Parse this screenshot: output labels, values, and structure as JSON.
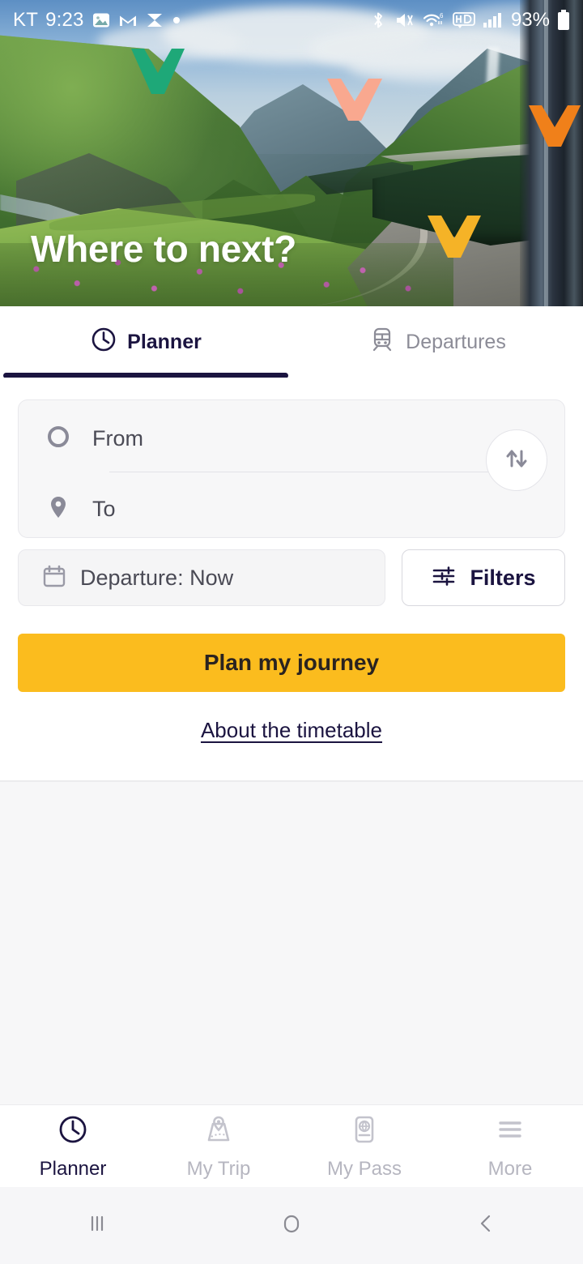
{
  "status_bar": {
    "carrier": "KT",
    "time": "9:23",
    "battery_percent": "93%",
    "left_icons": [
      "photos-icon",
      "gmail-icon",
      "capcut-icon",
      "dot-icon"
    ],
    "right_icons": [
      "bluetooth-icon",
      "vibrate-mute-icon",
      "wifi6-icon",
      "hd-icon",
      "signal-bars-icon",
      "battery-icon"
    ]
  },
  "hero": {
    "title": "Where to next?",
    "image_alt": "mountain-valley-train",
    "chevrons": [
      {
        "name": "chevron-green",
        "color": "#1EA878"
      },
      {
        "name": "chevron-salmon",
        "color": "#F9A88F"
      },
      {
        "name": "chevron-orange",
        "color": "#F0801A"
      },
      {
        "name": "chevron-yellow",
        "color": "#F5B327"
      }
    ]
  },
  "tabs": [
    {
      "label": "Planner",
      "icon": "clock-icon",
      "active": true
    },
    {
      "label": "Departures",
      "icon": "train-icon",
      "active": false
    }
  ],
  "form": {
    "from": {
      "label": "From",
      "icon": "circle-outline-icon",
      "value": ""
    },
    "to": {
      "label": "To",
      "icon": "map-pin-icon",
      "value": ""
    },
    "swap": {
      "name": "swap-button",
      "icon": "swap-arrows-icon"
    },
    "departure": {
      "label": "Departure: Now",
      "icon": "calendar-icon"
    },
    "filters": {
      "label": "Filters",
      "icon": "sliders-icon"
    },
    "submit": {
      "label": "Plan my journey"
    },
    "about_link": {
      "label": "About the timetable"
    }
  },
  "bottom_nav": [
    {
      "label": "Planner",
      "icon": "clock-icon",
      "active": true
    },
    {
      "label": "My Trip",
      "icon": "map-route-icon",
      "active": false
    },
    {
      "label": "My Pass",
      "icon": "passport-globe-icon",
      "active": false
    },
    {
      "label": "More",
      "icon": "hamburger-icon",
      "active": false
    }
  ],
  "system_nav": [
    {
      "name": "recents-button",
      "icon": "recents-icon"
    },
    {
      "name": "home-button",
      "icon": "home-circle-icon"
    },
    {
      "name": "back-button",
      "icon": "back-chevron-icon"
    }
  ],
  "colors": {
    "accent_yellow": "#FBBC1E",
    "brand_navy": "#1B1440",
    "muted_gray": "#8C8C97",
    "card_bg": "#F7F7F8"
  }
}
